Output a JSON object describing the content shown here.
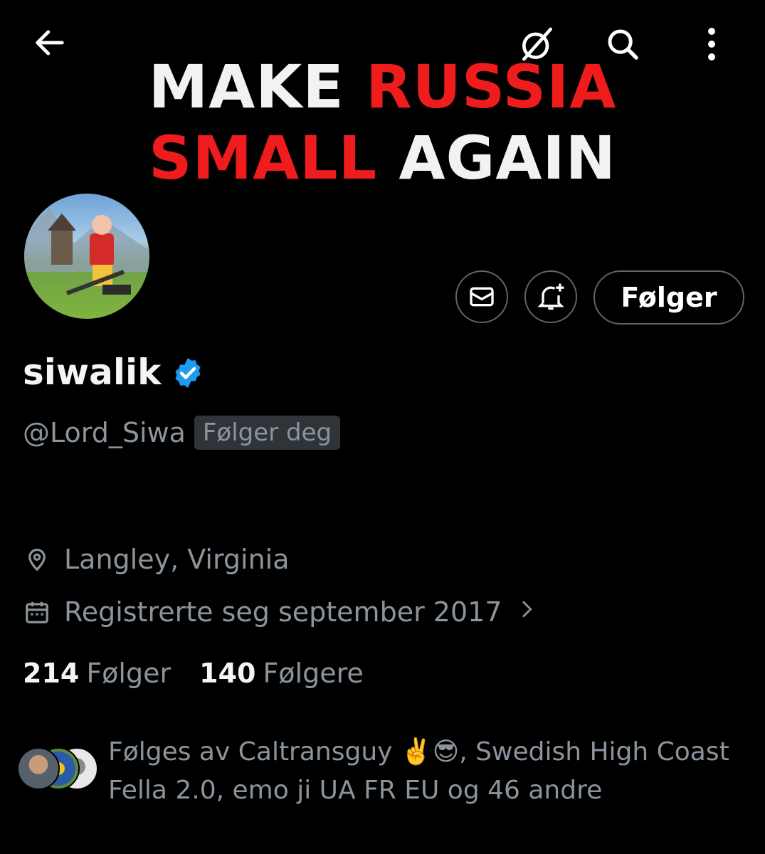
{
  "banner": {
    "line1_a": "MAKE",
    "line1_b": "RUSSIA",
    "line2_a": "SMALL",
    "line2_b": "AGAIN"
  },
  "icons": {
    "back": "arrow-left-icon",
    "grok": "grok-icon",
    "search": "search-icon",
    "more": "more-vertical-icon",
    "message": "envelope-icon",
    "bell": "bell-plus-icon",
    "verified": "verified-badge-icon",
    "location": "location-pin-icon",
    "calendar": "calendar-icon",
    "chevron": "chevron-right-icon"
  },
  "actions": {
    "follow_label": "Følger"
  },
  "profile": {
    "name": "siwalik",
    "handle": "@Lord_Siwa",
    "follows_you": "Følger deg",
    "location": "Langley, Virginia",
    "joined": "Registrerte seg september 2017"
  },
  "stats": {
    "following_count": "214",
    "following_label": "Følger",
    "followers_count": "140",
    "followers_label": "Følgere"
  },
  "followed_by": {
    "text": "Følges av Caltransguy ✌️😎, Swedish High Coast Fella 2.0, emo ji UA FR EU og 46 andre"
  },
  "colors": {
    "verified": "#1d9bf0",
    "banner_red": "#ee1c1c",
    "muted_text": "#8b949c"
  }
}
